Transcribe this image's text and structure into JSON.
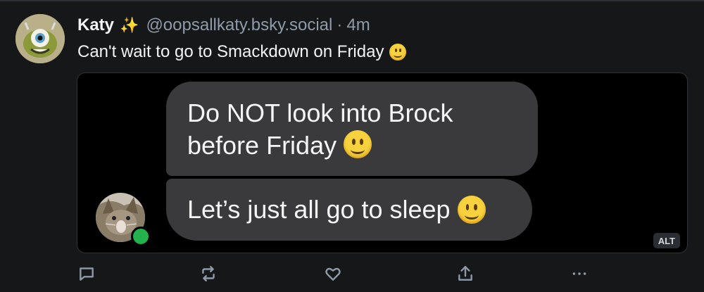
{
  "post": {
    "author_name": "Katy",
    "author_emoji": "✨",
    "handle": "@oopsallkaty.bsky.social",
    "separator": "·",
    "time": "4m",
    "text": "Can't wait to go to Smackdown on Friday"
  },
  "media": {
    "messages": [
      {
        "text": "Do NOT look into Brock before Friday"
      },
      {
        "text": "Let’s just all go to sleep"
      }
    ],
    "alt_label": "ALT"
  },
  "actions": [
    {
      "icon": "reply-icon"
    },
    {
      "icon": "repost-icon"
    },
    {
      "icon": "like-icon"
    },
    {
      "icon": "share-icon"
    },
    {
      "icon": "more-icon"
    }
  ]
}
